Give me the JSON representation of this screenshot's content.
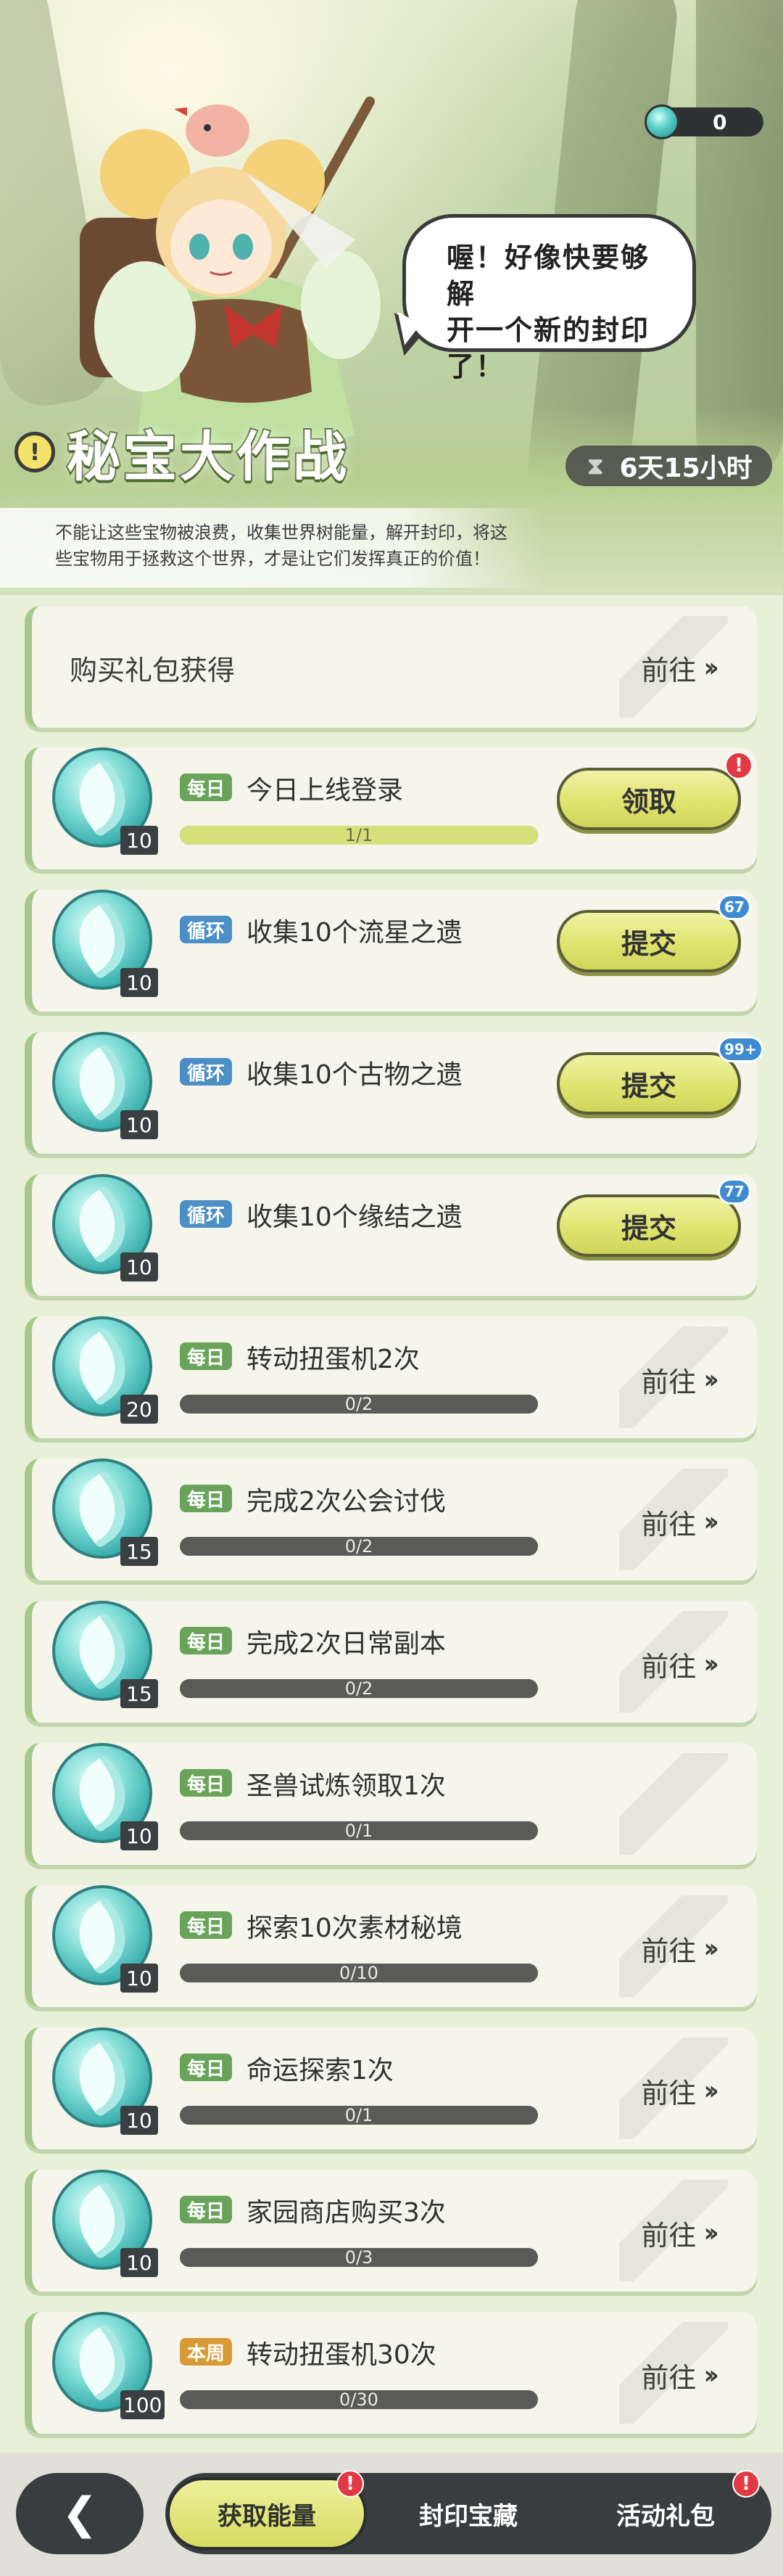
{
  "currency": {
    "amount": "0",
    "icon": "energy-gem-icon"
  },
  "speech_bubble": {
    "line1": "喔！好像快要够解",
    "line2": "开一个新的封印",
    "line3": "了！"
  },
  "header": {
    "title": "秘宝大作战",
    "timer": "6天15小时",
    "description_line1": "不能让这些宝物被浪费，收集世界树能量，解开封印，将这",
    "description_line2": "些宝物用于拯救这个世界，才是让它们发挥真正的价值！"
  },
  "gift": {
    "label": "购买礼包获得",
    "go": "前往"
  },
  "tasks": [
    {
      "tag": "每日",
      "tag_type": "daily",
      "name": "今日上线登录",
      "reward": "10",
      "progress": "1/1",
      "fill": 1.0,
      "action": "领取",
      "action_type": "button",
      "badge": "!",
      "badge_type": "red"
    },
    {
      "tag": "循环",
      "tag_type": "loop",
      "name": "收集10个流星之遗",
      "reward": "10",
      "progress": "",
      "fill": 0,
      "action": "提交",
      "action_type": "button",
      "badge": "67",
      "badge_type": "blue"
    },
    {
      "tag": "循环",
      "tag_type": "loop",
      "name": "收集10个古物之遗",
      "reward": "10",
      "progress": "",
      "fill": 0,
      "action": "提交",
      "action_type": "button",
      "badge": "99+",
      "badge_type": "blue"
    },
    {
      "tag": "循环",
      "tag_type": "loop",
      "name": "收集10个缘结之遗",
      "reward": "10",
      "progress": "",
      "fill": 0,
      "action": "提交",
      "action_type": "button",
      "badge": "77",
      "badge_type": "blue"
    },
    {
      "tag": "每日",
      "tag_type": "daily",
      "name": "转动扭蛋机2次",
      "reward": "20",
      "progress": "0/2",
      "fill": 0,
      "action": "前往",
      "action_type": "go"
    },
    {
      "tag": "每日",
      "tag_type": "daily",
      "name": "完成2次公会讨伐",
      "reward": "15",
      "progress": "0/2",
      "fill": 0,
      "action": "前往",
      "action_type": "go"
    },
    {
      "tag": "每日",
      "tag_type": "daily",
      "name": "完成2次日常副本",
      "reward": "15",
      "progress": "0/2",
      "fill": 0,
      "action": "前往",
      "action_type": "go"
    },
    {
      "tag": "每日",
      "tag_type": "daily",
      "name": "圣兽试炼领取1次",
      "reward": "10",
      "progress": "0/1",
      "fill": 0,
      "action": "",
      "action_type": "none"
    },
    {
      "tag": "每日",
      "tag_type": "daily",
      "name": "探索10次素材秘境",
      "reward": "10",
      "progress": "0/10",
      "fill": 0,
      "action": "前往",
      "action_type": "go"
    },
    {
      "tag": "每日",
      "tag_type": "daily",
      "name": "命运探索1次",
      "reward": "10",
      "progress": "0/1",
      "fill": 0,
      "action": "前往",
      "action_type": "go"
    },
    {
      "tag": "每日",
      "tag_type": "daily",
      "name": "家园商店购买3次",
      "reward": "10",
      "progress": "0/3",
      "fill": 0,
      "action": "前往",
      "action_type": "go"
    },
    {
      "tag": "本周",
      "tag_type": "weekly",
      "name": "转动扭蛋机30次",
      "reward": "100",
      "progress": "0/30",
      "fill": 0,
      "action": "前往",
      "action_type": "go"
    }
  ],
  "bottom_nav": {
    "back_icon": "back-arrow-icon",
    "tabs": [
      {
        "label": "获取能量",
        "active": true,
        "badge": "!"
      },
      {
        "label": "封印宝藏",
        "active": false,
        "badge": ""
      },
      {
        "label": "活动礼包",
        "active": false,
        "badge": "!"
      }
    ]
  },
  "colors": {
    "accent": "#dfe46f",
    "daily_tag": "#6aa45a",
    "loop_tag": "#4b8fc6",
    "weekly_tag": "#d79a35",
    "alert_red": "#e23a45"
  }
}
